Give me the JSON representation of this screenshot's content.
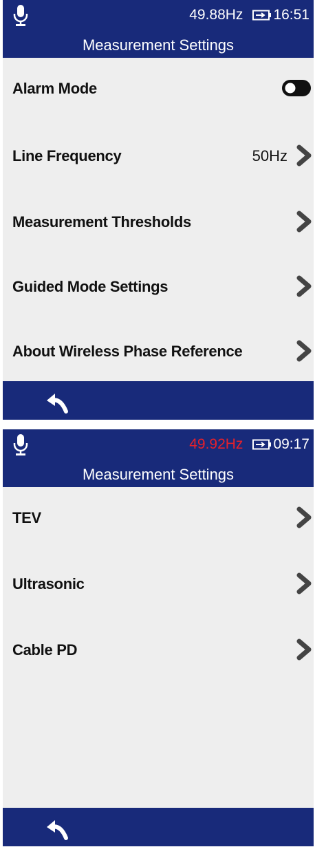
{
  "screens": [
    {
      "header": {
        "frequency": "49.88Hz",
        "frequency_color": "#ffffff",
        "time": "16:51",
        "title": "Measurement Settings"
      },
      "items": [
        {
          "label": "Alarm Mode",
          "toggle": "off"
        },
        {
          "label": "Line Frequency",
          "value": "50Hz"
        },
        {
          "label": "Measurement Thresholds"
        },
        {
          "label": "Guided Mode Settings"
        },
        {
          "label": "About Wireless Phase Reference"
        }
      ]
    },
    {
      "header": {
        "frequency": "49.92Hz",
        "frequency_color": "#e8202a",
        "time": "09:17",
        "title": "Measurement Settings"
      },
      "items": [
        {
          "label": "TEV"
        },
        {
          "label": "Ultrasonic"
        },
        {
          "label": "Cable PD"
        }
      ]
    }
  ],
  "colors": {
    "header_bg": "#182a7a",
    "content_bg": "#eeeeee",
    "chevron": "#444444",
    "alert": "#e8202a"
  },
  "icons": {
    "status_left": "microphone-icon",
    "battery": "battery-icon",
    "row": "chevron-right-icon",
    "footer": "back-arrow-icon",
    "toggle": "toggle-switch-icon"
  }
}
